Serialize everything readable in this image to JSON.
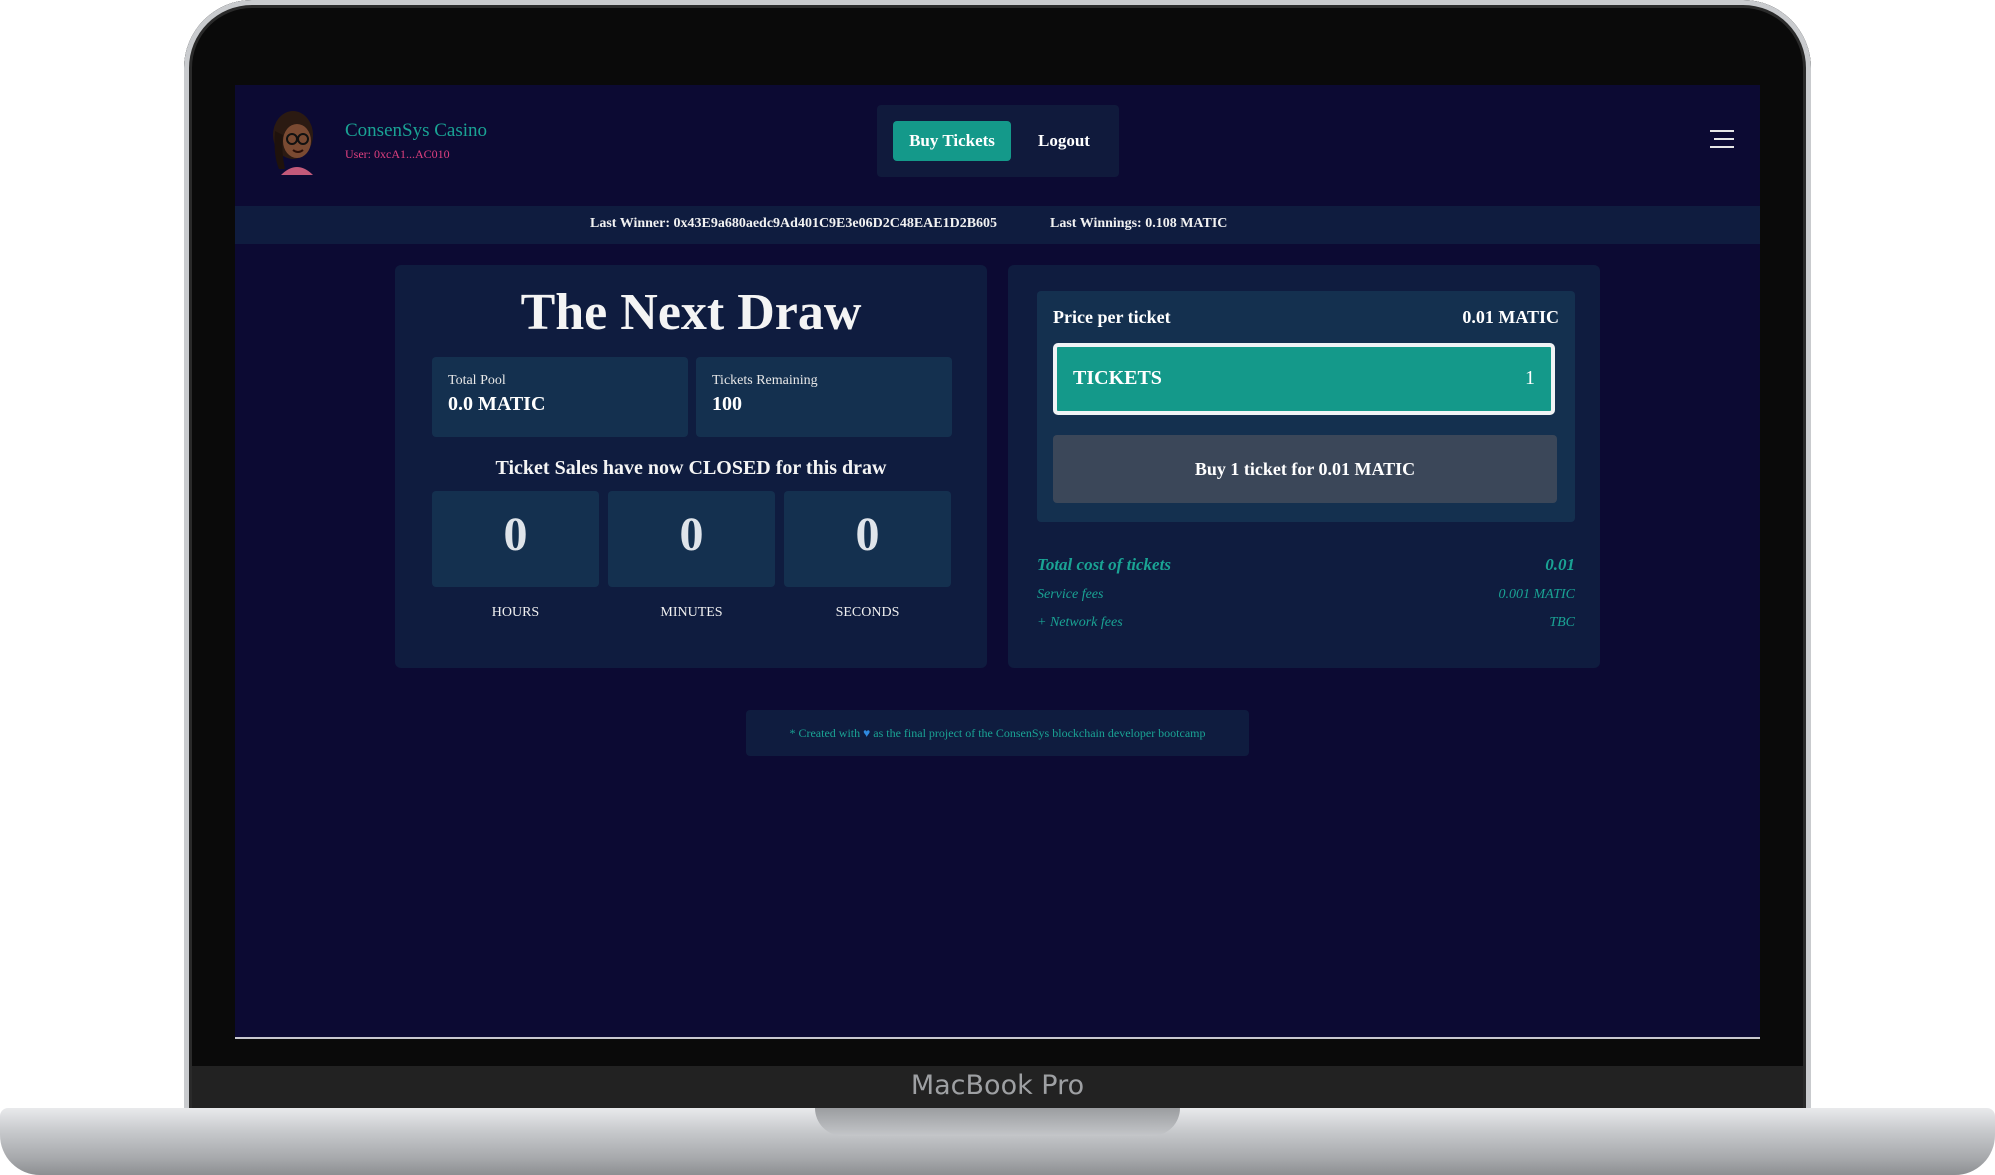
{
  "device": {
    "label": "MacBook Pro"
  },
  "navbar": {
    "site_name": "ConsenSys Casino",
    "user_address": "User: 0xcA1...AC010",
    "buy_tickets_label": "Buy Tickets",
    "logout_label": "Logout"
  },
  "winner_bar": {
    "last_winner": "Last Winner: 0x43E9a680aedc9Ad401C9E3e06D2C48EAE1D2B605",
    "last_winnings": "Last Winnings: 0.108 MATIC"
  },
  "draw": {
    "title": "The Next Draw",
    "total_pool_label": "Total Pool",
    "total_pool_value": "0.0 MATIC",
    "tickets_remaining_label": "Tickets Remaining",
    "tickets_remaining_value": "100",
    "status_message": "Ticket Sales have now CLOSED for this draw",
    "countdown": {
      "hours": "0",
      "minutes": "0",
      "seconds": "0",
      "hours_label": "HOURS",
      "minutes_label": "MINUTES",
      "seconds_label": "SECONDS"
    }
  },
  "purchase": {
    "price_label": "Price per ticket",
    "price_value": "0.01 MATIC",
    "tickets_label": "TICKETS",
    "tickets_quantity": "1",
    "buy_button_label": "Buy 1 ticket for 0.01 MATIC",
    "total_cost_label": "Total cost of tickets",
    "total_cost_value": "0.01",
    "service_fees_label": "Service fees",
    "service_fees_value": "0.001 MATIC",
    "network_fees_label": "+ Network fees",
    "network_fees_value": "TBC"
  },
  "footer": {
    "prefix": "* Created with",
    "suffix": "as the final project of the ConsenSys blockchain developer bootcamp"
  },
  "colors": {
    "background": "#0c0a33",
    "panel": "#0f1c3f",
    "accent": "#14998a",
    "user_address": "#e0407f"
  },
  "icons": [
    "avatar",
    "hamburger-menu-icon",
    "heart-icon"
  ]
}
